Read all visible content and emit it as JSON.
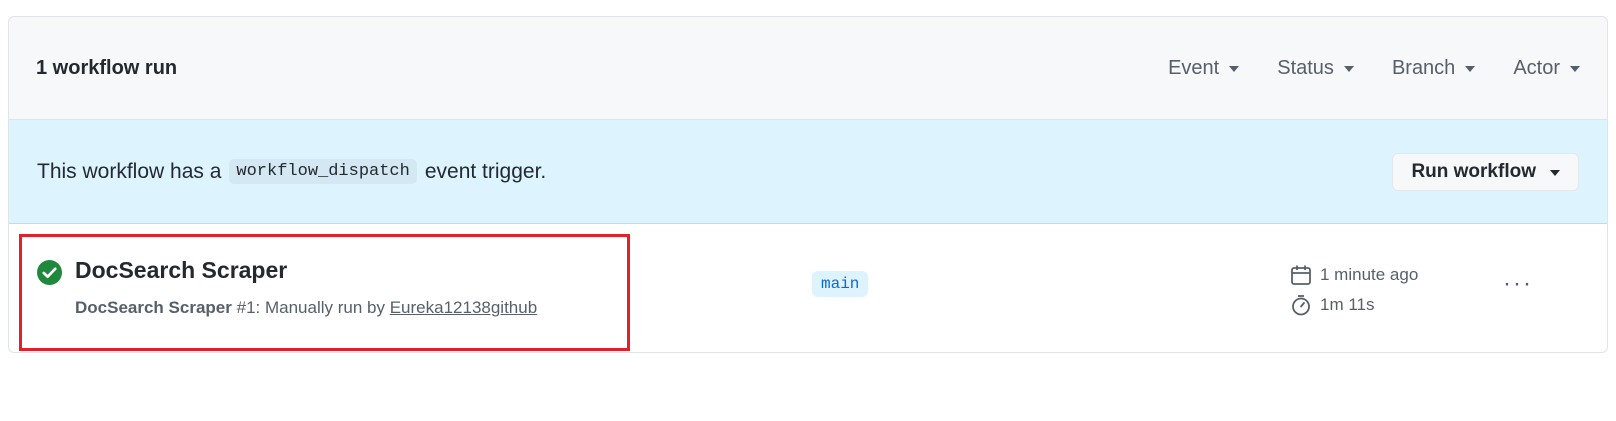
{
  "header": {
    "count_label": "1 workflow run",
    "filters": [
      {
        "label": "Event"
      },
      {
        "label": "Status"
      },
      {
        "label": "Branch"
      },
      {
        "label": "Actor"
      }
    ]
  },
  "banner": {
    "text_before": "This workflow has a",
    "code": "workflow_dispatch",
    "text_after": "event trigger.",
    "button_label": "Run workflow"
  },
  "run": {
    "status": "success",
    "status_color": "#1f883d",
    "title": "DocSearch Scraper",
    "workflow_name": "DocSearch Scraper",
    "run_number": "#1",
    "description": ": Manually run by",
    "actor": "Eureka12138github",
    "branch": "main",
    "time_ago": "1 minute ago",
    "duration": "1m 11s",
    "more_label": "···"
  },
  "colors": {
    "accent": "#0969da",
    "banner_bg": "#ddf4ff",
    "highlight": "#e3202a"
  },
  "icons": [
    "check-circle-icon",
    "calendar-icon",
    "stopwatch-icon",
    "kebab-menu-icon",
    "caret-down-icon"
  ]
}
